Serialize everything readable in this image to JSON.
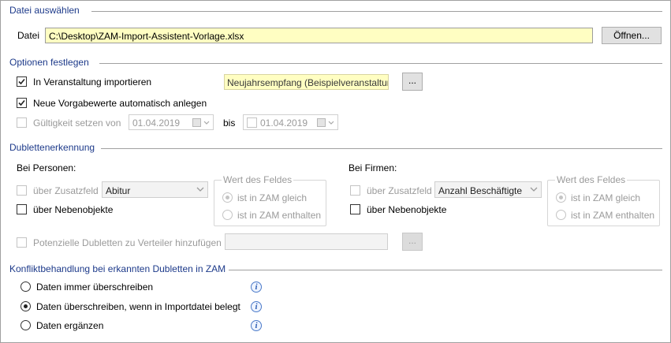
{
  "datei": {
    "section_title": "Datei auswählen",
    "label": "Datei",
    "path_value": "C:\\Desktop\\ZAM-Import-Assistent-Vorlage.xlsx",
    "open_button": "Öffnen..."
  },
  "optionen": {
    "section_title": "Optionen festlegen",
    "import_event": {
      "label": "In Veranstaltung importieren",
      "checked": true,
      "event_value": "Neujahrsempfang (Beispielveranstaltun",
      "browse_button": "..."
    },
    "defaults": {
      "label": "Neue Vorgabewerte automatisch anlegen",
      "checked": true
    },
    "validity": {
      "label": "Gültigkeit setzen von",
      "checked": false,
      "enabled": false,
      "from_date": "01.04.2019",
      "to_label": "bis",
      "to_date": "01.04.2019"
    }
  },
  "dubletten": {
    "section_title": "Dublettenerkennung",
    "personen": {
      "title": "Bei Personen:",
      "zusatzfeld_label": "über Zusatzfeld",
      "zusatzfeld_value": "Abitur",
      "nebenobjekte_label": "über Nebenobjekte",
      "group_title": "Wert des Feldes",
      "radio_equal": "ist in ZAM gleich",
      "radio_contains": "ist in ZAM enthalten"
    },
    "firmen": {
      "title": "Bei Firmen:",
      "zusatzfeld_label": "über Zusatzfeld",
      "zusatzfeld_value": "Anzahl Beschäftigte",
      "nebenobjekte_label": "über Nebenobjekte",
      "group_title": "Wert des Feldes",
      "radio_equal": "ist in ZAM gleich",
      "radio_contains": "ist in ZAM enthalten"
    },
    "verteiler": {
      "label": "Potenzielle Dubletten zu Verteiler hinzufügen",
      "value": "",
      "browse_button": "..."
    }
  },
  "konflikt": {
    "section_title": "Konfliktbehandlung bei erkannten Dubletten in ZAM",
    "options": [
      {
        "label": "Daten immer überschreiben",
        "selected": false
      },
      {
        "label": "Daten überschreiben, wenn in Importdatei belegt",
        "selected": true
      },
      {
        "label": "Daten ergänzen",
        "selected": false
      }
    ],
    "info_glyph": "i"
  }
}
